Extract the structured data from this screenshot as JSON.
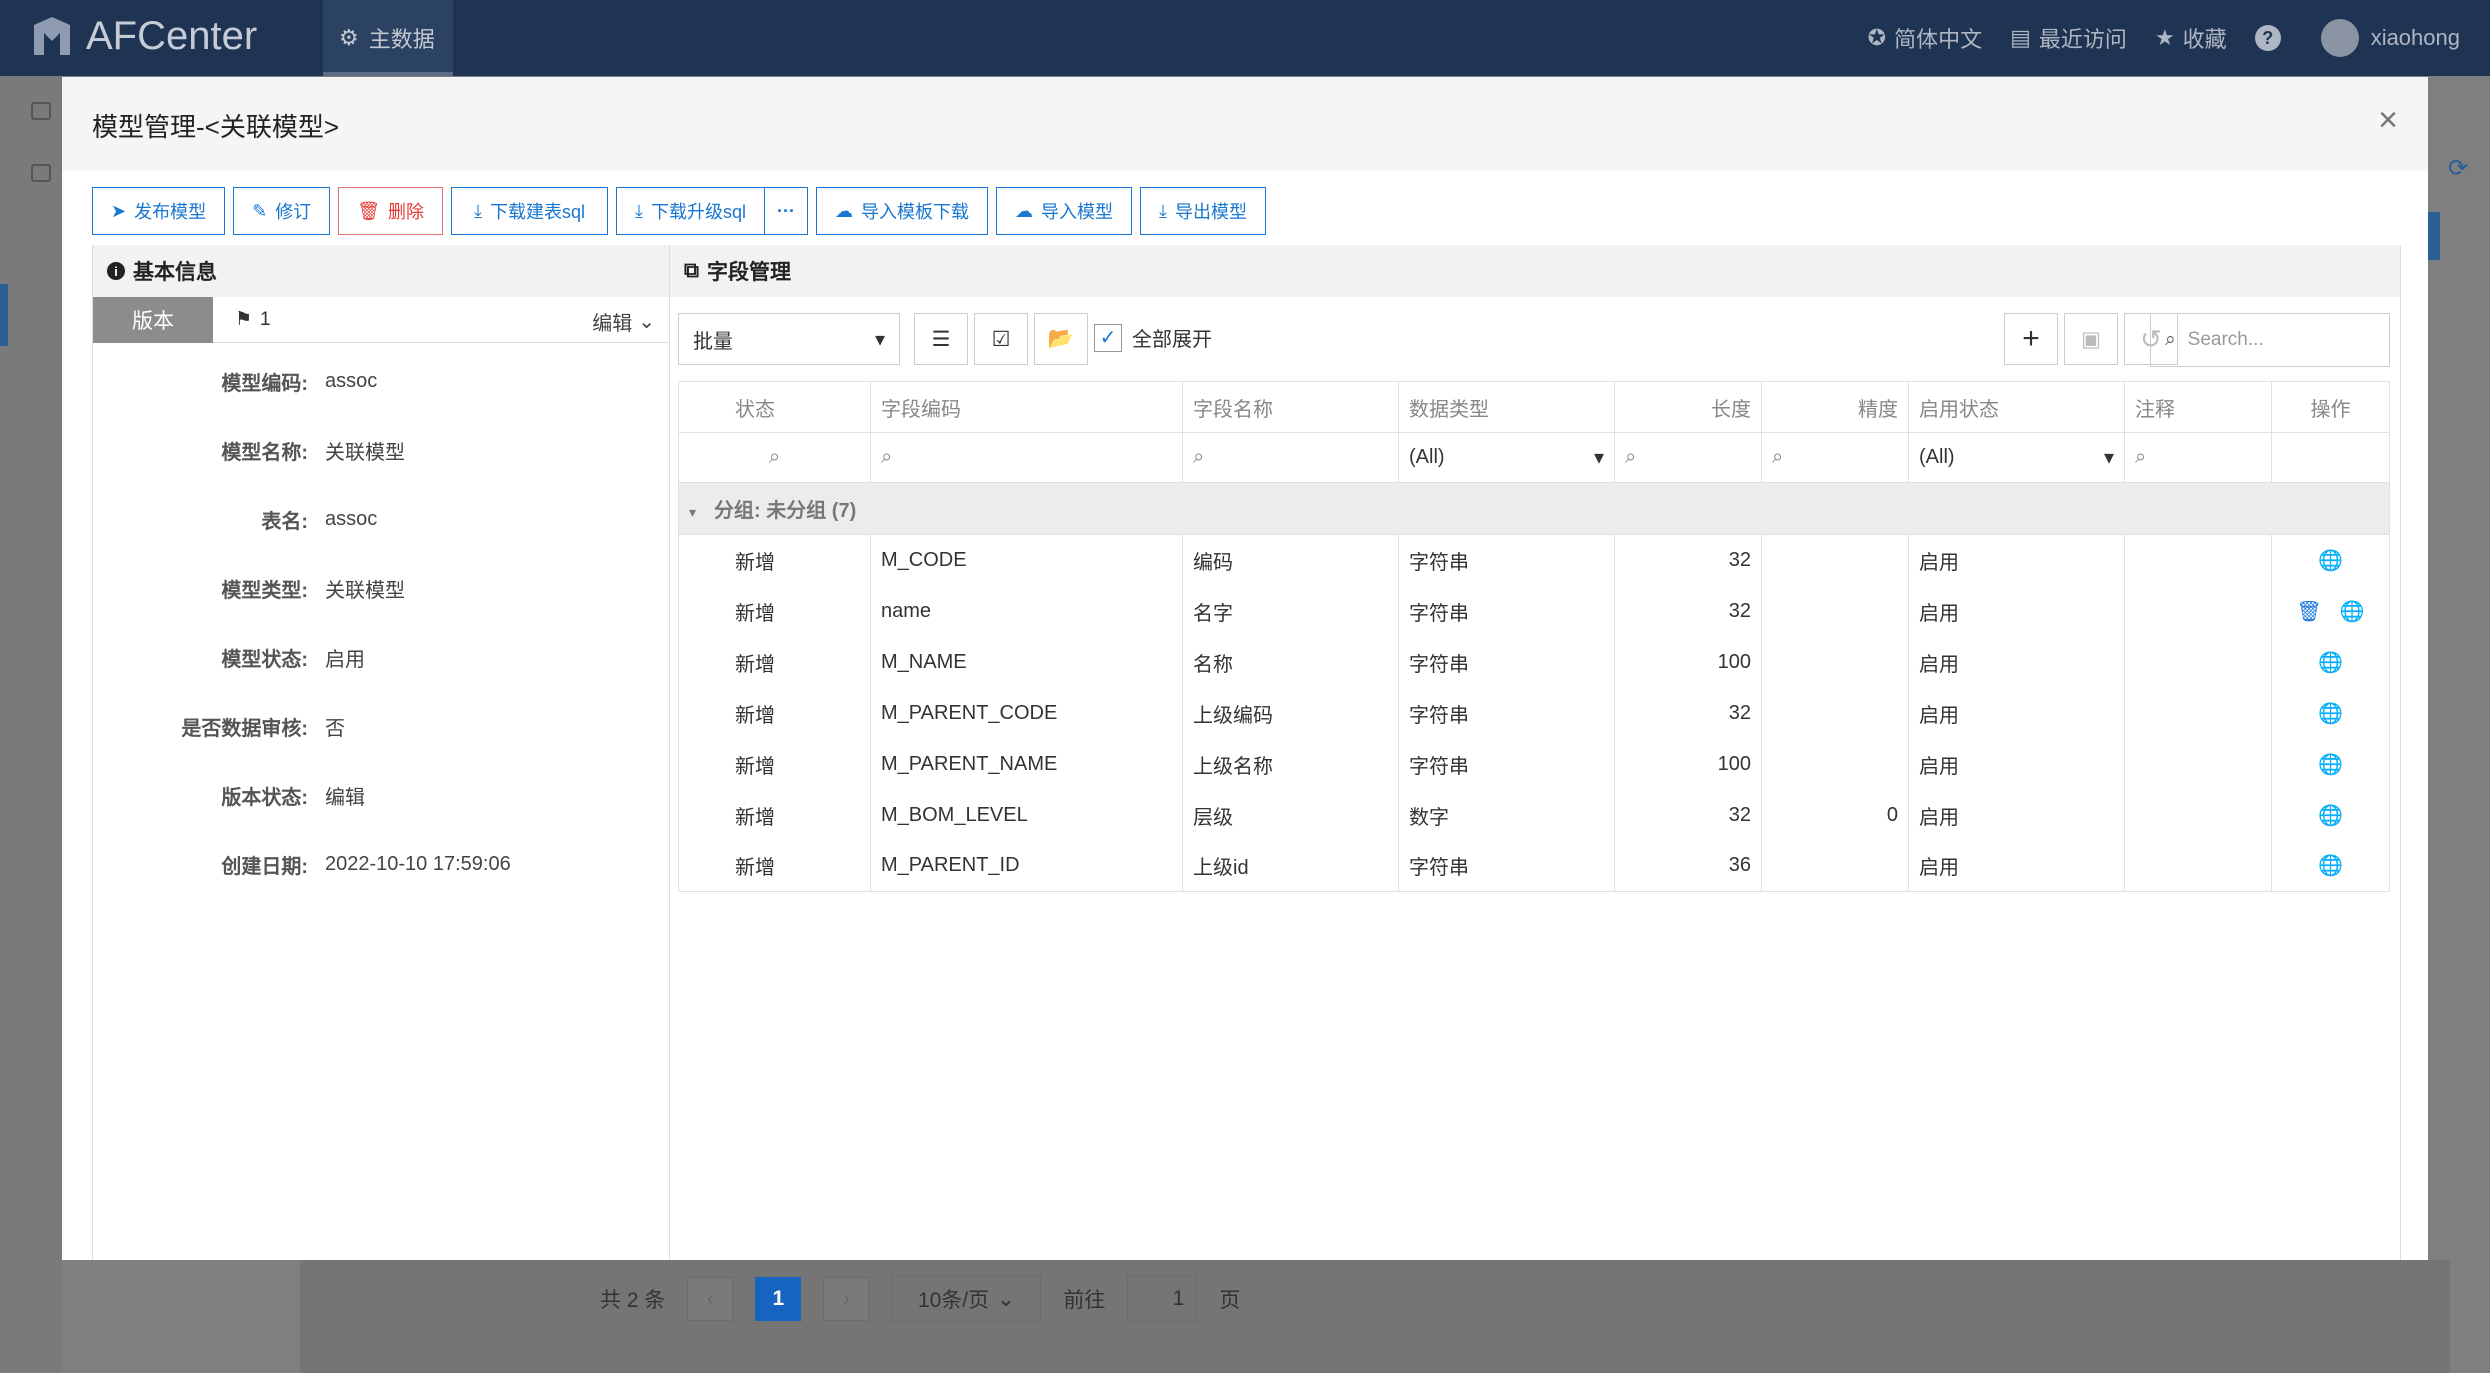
{
  "app": {
    "name": "AFCenter",
    "nav_item": "主数据",
    "lang": "简体中文",
    "recent": "最近访问",
    "favorites": "收藏",
    "help": "?",
    "user": "xiaohong"
  },
  "pager": {
    "total": "共 2 条",
    "current_page": "1",
    "page_size": "10条/页",
    "goto_label": "前往",
    "goto_value": "1",
    "page_suffix": "页"
  },
  "modal": {
    "title": "模型管理-<关联模型>"
  },
  "toolbar": {
    "publish": "发布模型",
    "revise": "修订",
    "delete": "删除",
    "download_create_sql": "下载建表sql",
    "download_upgrade_sql": "下载升级sql",
    "more": "···",
    "import_template_download": "导入模板下载",
    "import_model": "导入模型",
    "export_model": "导出模型"
  },
  "basic": {
    "title": "基本信息",
    "version_tab": "版本",
    "version_value": "1",
    "edit_label": "编辑",
    "fields": [
      {
        "label": "模型编码:",
        "value": "assoc"
      },
      {
        "label": "模型名称:",
        "value": "关联模型"
      },
      {
        "label": "表名:",
        "value": "assoc"
      },
      {
        "label": "模型类型:",
        "value": "关联模型"
      },
      {
        "label": "模型状态:",
        "value": "启用"
      },
      {
        "label": "是否数据审核:",
        "value": "否"
      },
      {
        "label": "版本状态:",
        "value": "编辑"
      },
      {
        "label": "创建日期:",
        "value": "2022-10-10 17:59:06"
      }
    ]
  },
  "fields_panel": {
    "title": "字段管理",
    "batch": "批量",
    "expand_all": "全部展开",
    "search_placeholder": "Search...",
    "columns": [
      "状态",
      "字段编码",
      "字段名称",
      "数据类型",
      "长度",
      "精度",
      "启用状态",
      "注释",
      "操作"
    ],
    "filter_all": "(All)",
    "group_label": "分组: 未分组 (7)",
    "rows": [
      {
        "status": "新增",
        "code": "M_CODE",
        "name": "编码",
        "type": "字符串",
        "length": "32",
        "precision": "",
        "enabled": "启用",
        "comment": ""
      },
      {
        "status": "新增",
        "code": "name",
        "name": "名字",
        "type": "字符串",
        "length": "32",
        "precision": "",
        "enabled": "启用",
        "comment": ""
      },
      {
        "status": "新增",
        "code": "M_NAME",
        "name": "名称",
        "type": "字符串",
        "length": "100",
        "precision": "",
        "enabled": "启用",
        "comment": ""
      },
      {
        "status": "新增",
        "code": "M_PARENT_CODE",
        "name": "上级编码",
        "type": "字符串",
        "length": "32",
        "precision": "",
        "enabled": "启用",
        "comment": ""
      },
      {
        "status": "新增",
        "code": "M_PARENT_NAME",
        "name": "上级名称",
        "type": "字符串",
        "length": "100",
        "precision": "",
        "enabled": "启用",
        "comment": ""
      },
      {
        "status": "新增",
        "code": "M_BOM_LEVEL",
        "name": "层级",
        "type": "数字",
        "length": "32",
        "precision": "0",
        "enabled": "启用",
        "comment": ""
      },
      {
        "status": "新增",
        "code": "M_PARENT_ID",
        "name": "上级id",
        "type": "字符串",
        "length": "36",
        "precision": "",
        "enabled": "启用",
        "comment": ""
      }
    ]
  }
}
